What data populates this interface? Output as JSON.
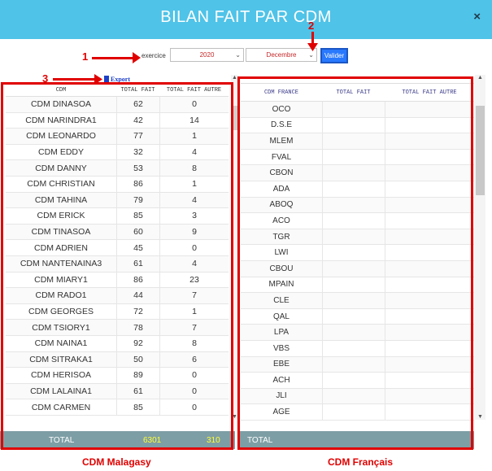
{
  "modal": {
    "title": "BILAN FAIT PAR CDM",
    "close_label": "×"
  },
  "filters": {
    "exercice_label": "exercice",
    "year_value": "2020",
    "month_value": "Decembre",
    "validate_label": "Valider"
  },
  "annotations": {
    "one": "1",
    "two": "2",
    "three": "3"
  },
  "export_label": "Export",
  "left_table": {
    "headers": [
      "CDM",
      "TOTAL FAIT",
      "TOTAL FAIT AUTRE"
    ],
    "rows": [
      [
        "CDM DINASOA",
        "62",
        "0"
      ],
      [
        "CDM NARINDRA1",
        "42",
        "14"
      ],
      [
        "CDM LEONARDO",
        "77",
        "1"
      ],
      [
        "CDM EDDY",
        "32",
        "4"
      ],
      [
        "CDM DANNY",
        "53",
        "8"
      ],
      [
        "CDM CHRISTIAN",
        "86",
        "1"
      ],
      [
        "CDM TAHINA",
        "79",
        "4"
      ],
      [
        "CDM ERICK",
        "85",
        "3"
      ],
      [
        "CDM TINASOA",
        "60",
        "9"
      ],
      [
        "CDM ADRIEN",
        "45",
        "0"
      ],
      [
        "CDM NANTENAINA3",
        "61",
        "4"
      ],
      [
        "CDM MIARY1",
        "86",
        "23"
      ],
      [
        "CDM RADO1",
        "44",
        "7"
      ],
      [
        "CDM GEORGES",
        "72",
        "1"
      ],
      [
        "CDM TSIORY1",
        "78",
        "7"
      ],
      [
        "CDM NAINA1",
        "92",
        "8"
      ],
      [
        "CDM SITRAKA1",
        "50",
        "6"
      ],
      [
        "CDM HERISOA",
        "89",
        "0"
      ],
      [
        "CDM LALAINA1",
        "61",
        "0"
      ],
      [
        "CDM CARMEN",
        "85",
        "0"
      ]
    ],
    "footer": {
      "label": "TOTAL",
      "total_fait": "6301",
      "total_fait_autre": "310"
    }
  },
  "right_table": {
    "headers": [
      "CDM FRANCE",
      "TOTAL FAIT",
      "TOTAL FAIT AUTRE"
    ],
    "rows": [
      "OCO",
      "D.S.E",
      "MLEM",
      "FVAL",
      "CBON",
      "ADA",
      "ABOQ",
      "ACO",
      "TGR",
      "LWI",
      "CBOU",
      "MPAIN",
      "CLE",
      "QAL",
      "LPA",
      "VBS",
      "EBE",
      "ACH",
      "JLI",
      "AGE"
    ],
    "footer": {
      "label": "TOTAL"
    }
  },
  "captions": {
    "left": "CDM Malagasy",
    "right": "CDM Français"
  },
  "colors": {
    "header": "#4fc3e8",
    "annotation": "#e00000",
    "footer": "#7e9ea5",
    "footer_value": "#ffff33",
    "valider": "#2979ff"
  }
}
